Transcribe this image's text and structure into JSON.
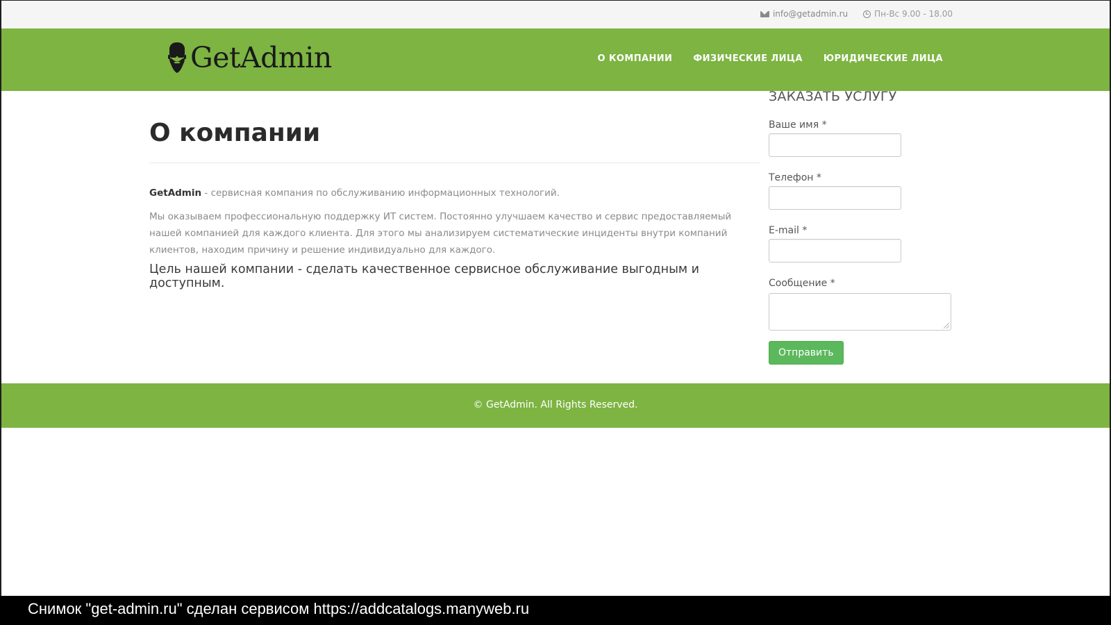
{
  "topbar": {
    "email_icon": "envelope-icon",
    "email": "info@getadmin.ru",
    "hours_icon": "clock-icon",
    "hours": "Пн-Вс 9.00 - 18.00"
  },
  "header": {
    "logo_icon": "bearded-man-logo",
    "logo_text": "GetAdmin",
    "nav": [
      {
        "label": "О КОМПАНИИ"
      },
      {
        "label": "ФИЗИЧЕСКИЕ ЛИЦА"
      },
      {
        "label": "ЮРИДИЧЕСКИЕ ЛИЦА"
      }
    ]
  },
  "main": {
    "title": "О компании",
    "intro_brand": "GetAdmin",
    "intro_rest": " - сервисная компания по обслуживанию информационных технологий.",
    "paragraph": "Мы оказываем профессиональную поддержку ИТ систем. Постоянно улучшаем качество и сервис предоставляемый нашей компанией для каждого клиента. Для этого мы анализируем систематические инциденты внутри компаний клиентов, находим причину и решение индивидуально для каждого.",
    "goal": "Цель нашей компании - сделать качественное сервисное обслуживание выгодным и доступным."
  },
  "form": {
    "title": "ЗАКАЗАТЬ УСЛУГУ",
    "name_label": "Ваше имя *",
    "name_value": "",
    "phone_label": "Телефон *",
    "phone_value": "",
    "email_label": "E-mail *",
    "email_value": "",
    "message_label": "Сообщение *",
    "message_value": "",
    "submit_label": "Отправить"
  },
  "footer": {
    "copyright": "© GetAdmin. All Rights Reserved."
  },
  "caption": {
    "text": "Снимок \"get-admin.ru\" сделан сервисом https://addcatalogs.manyweb.ru"
  },
  "colors": {
    "brand_green": "#7db442",
    "button_green": "#5cb85c",
    "topbar_bg": "#f5f5f5"
  }
}
